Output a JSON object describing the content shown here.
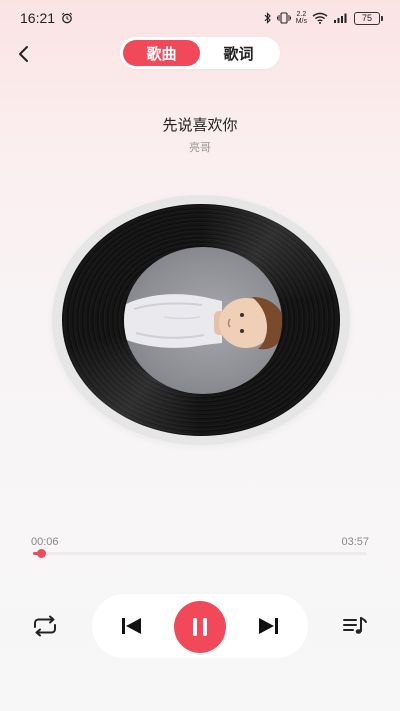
{
  "status_bar": {
    "time": "16:21",
    "net_speed_value": "2.2",
    "net_speed_unit": "M/s",
    "battery": "75"
  },
  "header": {
    "tabs": [
      {
        "label": "歌曲",
        "active": true
      },
      {
        "label": "歌词",
        "active": false
      }
    ]
  },
  "song": {
    "title": "先说喜欢你",
    "artist": "亮哥"
  },
  "player": {
    "elapsed": "00:06",
    "total": "03:57",
    "progress_fraction": 0.025,
    "state": "playing"
  },
  "icons": {
    "back": "back-chevron-icon",
    "repeat": "repeat-icon",
    "prev": "skip-previous-icon",
    "pause": "pause-icon",
    "next": "skip-next-icon",
    "playlist": "playlist-icon"
  },
  "colors": {
    "accent": "#f1495a"
  }
}
